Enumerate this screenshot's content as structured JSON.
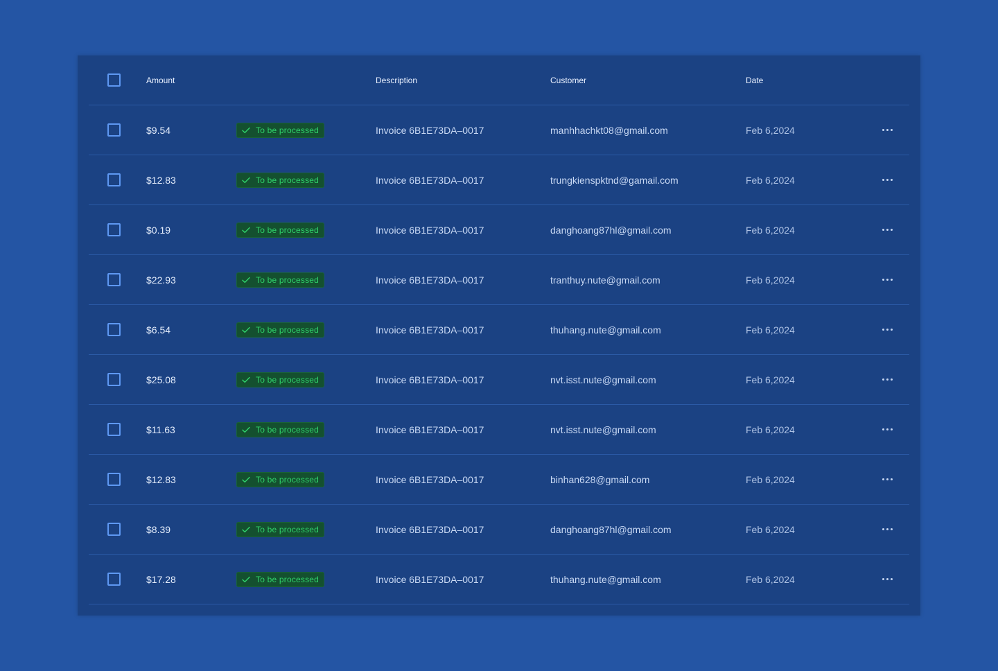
{
  "table": {
    "columns": {
      "amount": "Amount",
      "status": "",
      "description": "Description",
      "customer": "Customer",
      "date": "Date"
    },
    "rows": [
      {
        "amount": "$9.54",
        "status": "To be processed",
        "description": "Invoice 6B1E73DA–0017",
        "customer": "manhhachkt08@gmail.com",
        "date": "Feb 6,2024"
      },
      {
        "amount": "$12.83",
        "status": "To be processed",
        "description": "Invoice 6B1E73DA–0017",
        "customer": "trungkienspktnd@gamail.com",
        "date": "Feb 6,2024"
      },
      {
        "amount": "$0.19",
        "status": "To be processed",
        "description": "Invoice 6B1E73DA–0017",
        "customer": "danghoang87hl@gmail.com",
        "date": "Feb 6,2024"
      },
      {
        "amount": "$22.93",
        "status": "To be processed",
        "description": "Invoice 6B1E73DA–0017",
        "customer": "tranthuy.nute@gmail.com",
        "date": "Feb 6,2024"
      },
      {
        "amount": "$6.54",
        "status": "To be processed",
        "description": "Invoice 6B1E73DA–0017",
        "customer": "thuhang.nute@gmail.com",
        "date": "Feb 6,2024"
      },
      {
        "amount": "$25.08",
        "status": "To be processed",
        "description": "Invoice 6B1E73DA–0017",
        "customer": "nvt.isst.nute@gmail.com",
        "date": "Feb 6,2024"
      },
      {
        "amount": "$11.63",
        "status": "To be processed",
        "description": "Invoice 6B1E73DA–0017",
        "customer": "nvt.isst.nute@gmail.com",
        "date": "Feb 6,2024"
      },
      {
        "amount": "$12.83",
        "status": "To be processed",
        "description": "Invoice 6B1E73DA–0017",
        "customer": "binhan628@gmail.com",
        "date": "Feb 6,2024"
      },
      {
        "amount": "$8.39",
        "status": "To be processed",
        "description": "Invoice 6B1E73DA–0017",
        "customer": "danghoang87hl@gmail.com",
        "date": "Feb 6,2024"
      },
      {
        "amount": "$17.28",
        "status": "To be processed",
        "description": "Invoice 6B1E73DA–0017",
        "customer": "thuhang.nute@gmail.com",
        "date": "Feb 6,2024"
      }
    ]
  },
  "icons": {
    "status": "check-icon",
    "row_actions": "more-horizontal-icon"
  },
  "colors": {
    "background": "#2455a4",
    "card": "#1b4283",
    "status_text": "#2fd36a",
    "status_bg": "#14502f",
    "checkbox": "#5e98f2"
  }
}
